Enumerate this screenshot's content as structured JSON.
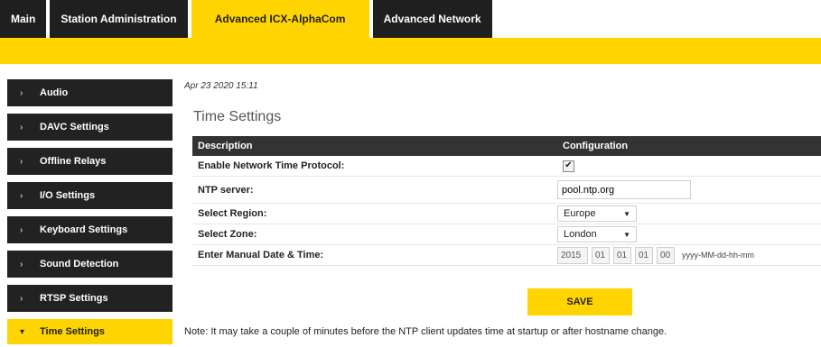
{
  "tabs": [
    {
      "label": "Main",
      "active": false
    },
    {
      "label": "Station Administration",
      "active": false
    },
    {
      "label": "Advanced ICX-AlphaCom",
      "active": true
    },
    {
      "label": "Advanced Network",
      "active": false
    }
  ],
  "colors": {
    "accent": "#ffd400",
    "dark": "#222222"
  },
  "sidebar": {
    "items": [
      {
        "label": "Audio"
      },
      {
        "label": "DAVC Settings"
      },
      {
        "label": "Offline Relays"
      },
      {
        "label": "I/O Settings"
      },
      {
        "label": "Keyboard Settings"
      },
      {
        "label": "Sound Detection"
      },
      {
        "label": "RTSP Settings"
      },
      {
        "label": "Time Settings",
        "active": true
      }
    ]
  },
  "main": {
    "timestamp": "Apr 23 2020 15:11",
    "title": "Time Settings",
    "table": {
      "headers": [
        "Description",
        "Configuration"
      ],
      "rows": {
        "ntp_enable": {
          "label": "Enable Network Time Protocol:",
          "checked": true
        },
        "ntp_server": {
          "label": "NTP server:",
          "value": "pool.ntp.org"
        },
        "region": {
          "label": "Select Region:",
          "value": "Europe"
        },
        "zone": {
          "label": "Select Zone:",
          "value": "London"
        },
        "manual_datetime": {
          "label": "Enter Manual Date & Time:",
          "year": "2015",
          "month": "01",
          "day": "01",
          "hour": "01",
          "minute": "00",
          "format_hint": "yyyy-MM-dd-hh-mm"
        }
      }
    },
    "save_label": "SAVE",
    "note": "Note: It may take a couple of minutes before the NTP client updates time at startup or after hostname change."
  }
}
